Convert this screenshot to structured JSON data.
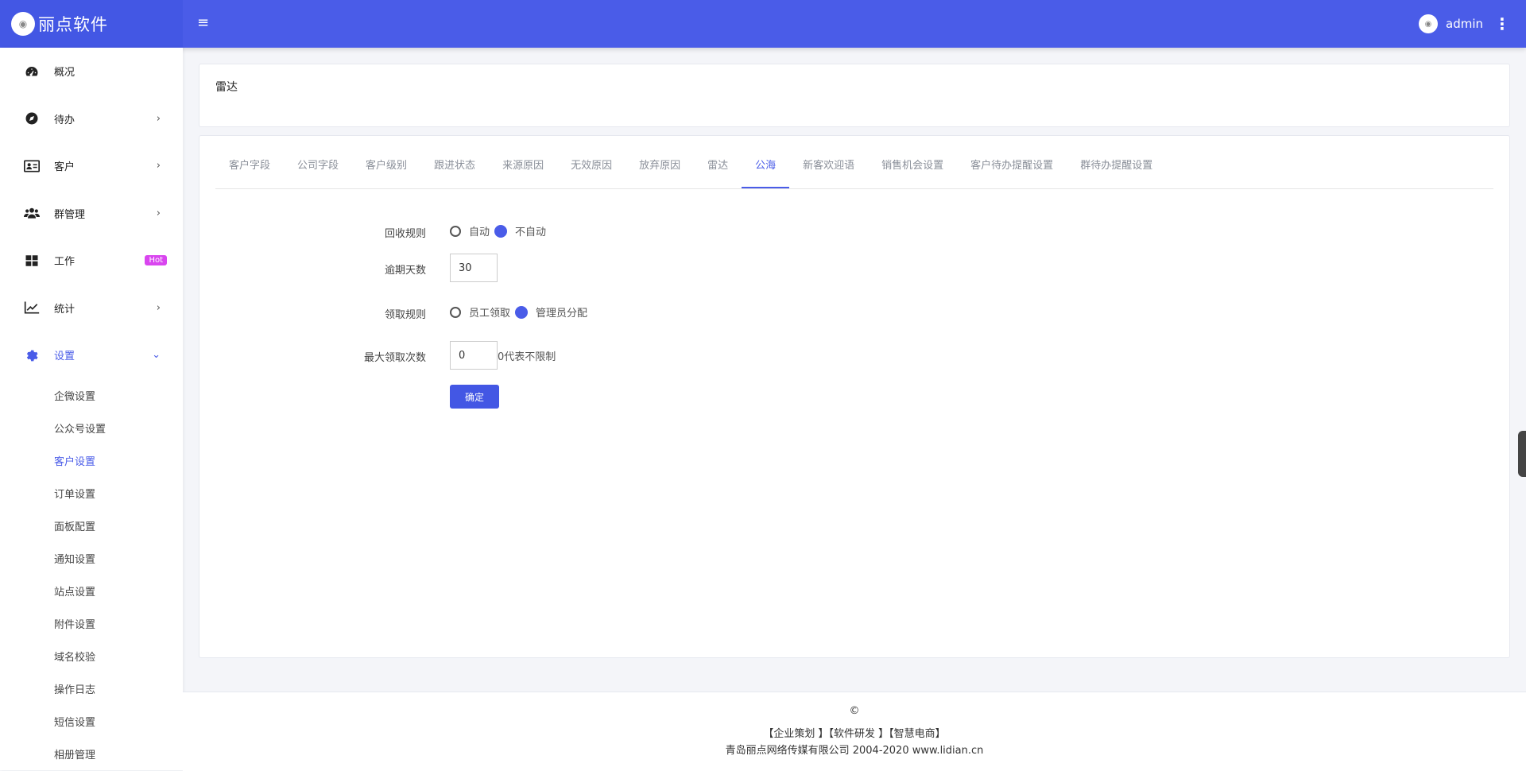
{
  "brand": {
    "logo_text": "◉",
    "name": "丽点软件"
  },
  "topbar": {
    "menu_icon": "≡",
    "user_name": "admin",
    "more_icon": "⋮"
  },
  "sidebar": {
    "items": [
      {
        "label": "概况",
        "icon": "dashboard-icon"
      },
      {
        "label": "待办",
        "icon": "compass-icon",
        "chevron": "›"
      },
      {
        "label": "客户",
        "icon": "id-card-icon",
        "chevron": "›"
      },
      {
        "label": "群管理",
        "icon": "users-icon",
        "chevron": "›"
      },
      {
        "label": "工作",
        "icon": "grid-icon",
        "badge": "Hot"
      },
      {
        "label": "统计",
        "icon": "chart-line-icon",
        "chevron": "›"
      },
      {
        "label": "设置",
        "icon": "gear-icon",
        "chevron": "⌄"
      }
    ],
    "sub_items": [
      "企微设置",
      "公众号设置",
      "客户设置",
      "订单设置",
      "面板配置",
      "通知设置",
      "站点设置",
      "附件设置",
      "域名校验",
      "操作日志",
      "短信设置",
      "相册管理"
    ],
    "active_sub": "客户设置"
  },
  "page": {
    "title": "雷达"
  },
  "tabs": [
    "客户字段",
    "公司字段",
    "客户级别",
    "跟进状态",
    "来源原因",
    "无效原因",
    "放弃原因",
    "雷达",
    "公海",
    "新客欢迎语",
    "销售机会设置",
    "客户待办提醒设置",
    "群待办提醒设置"
  ],
  "active_tab": "公海",
  "form": {
    "recycle_rule": {
      "label": "回收规则",
      "option1": "自动",
      "option2": "不自动",
      "selected": "不自动"
    },
    "overdue_days": {
      "label": "逾期天数",
      "value": "30"
    },
    "claim_rule": {
      "label": "领取规则",
      "option1": "员工领取",
      "option2": "管理员分配",
      "selected": "管理员分配"
    },
    "max_claims": {
      "label": "最大领取次数",
      "value": "0",
      "hint": "0代表不限制"
    },
    "submit_label": "确定"
  },
  "footer": {
    "copyright": "©",
    "links": "【企业策划 】【软件研发 】【智慧电商】",
    "company": "青岛丽点网络传媒有限公司 2004-2020 www.lidian.cn"
  },
  "colors": {
    "primary": "#4a5ce8",
    "hot_badge": "#d946ef"
  }
}
